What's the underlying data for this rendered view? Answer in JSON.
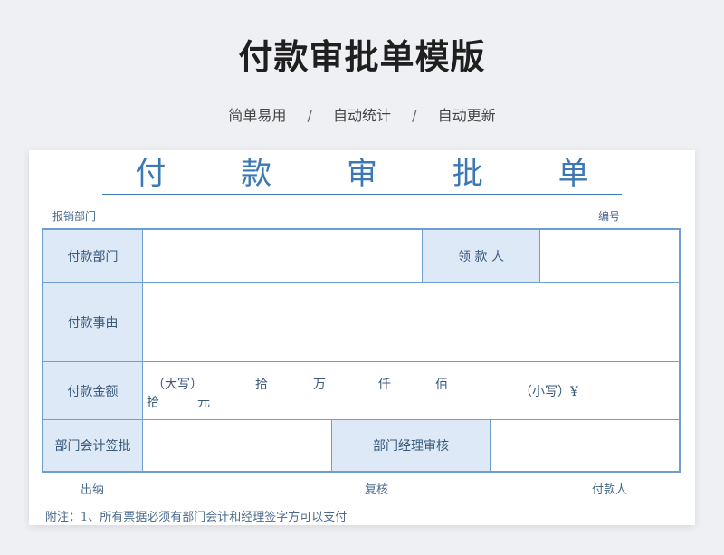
{
  "header": {
    "title": "付款审批单模版",
    "tags": [
      "简单易用",
      "自动统计",
      "自动更新"
    ],
    "separator": "/"
  },
  "form": {
    "title": "付 款 审 批 单",
    "dept_label": "报销部门",
    "number_label": "编号",
    "rows": {
      "pay_dept": "付款部门",
      "payee": "领 款 人",
      "reason": "付款事由",
      "amount": "付款金额",
      "dept_sign": "部门会计签批",
      "manager_review": "部门经理审核"
    },
    "amount": {
      "upper_label": "（大写）",
      "units": [
        "拾",
        "万",
        "仟",
        "佰",
        "拾",
        "元"
      ],
      "lower_label": "（小写）¥"
    },
    "footer": {
      "cashier": "出纳",
      "recheck": "复核",
      "payer": "付款人"
    },
    "note": "附注：1、所有票据必须有部门会计和经理签字方可以支付"
  }
}
